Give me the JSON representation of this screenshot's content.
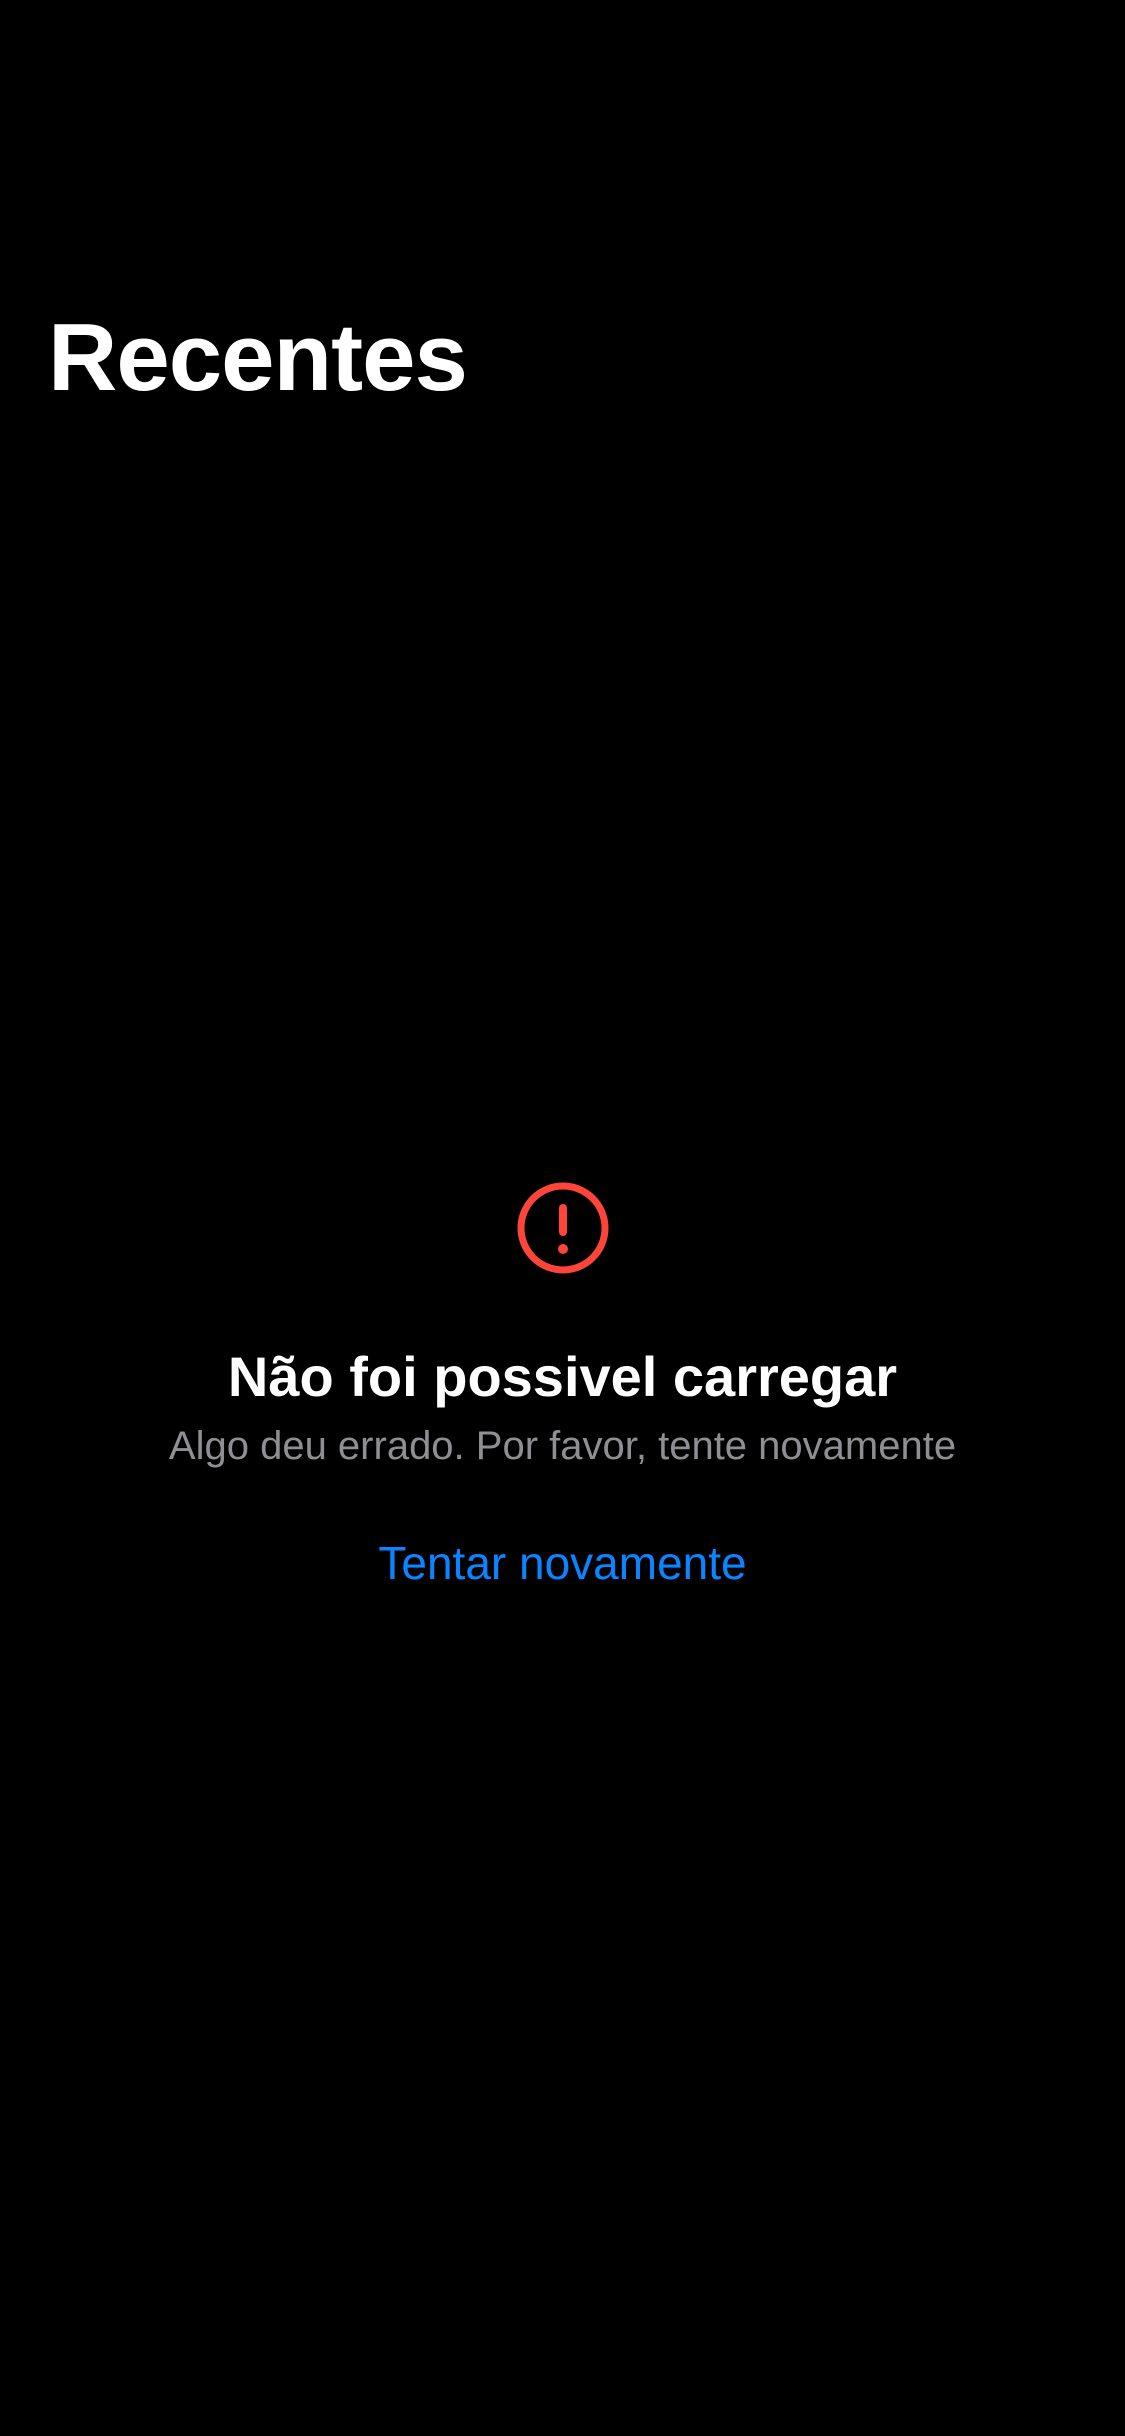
{
  "header": {
    "title": "Recentes"
  },
  "error_state": {
    "icon": "exclamation-circle-icon",
    "title": "Não foi possivel carregar",
    "message": "Algo deu errado. Por favor, tente novamente",
    "retry_label": "Tentar novamente"
  },
  "colors": {
    "background": "#000000",
    "title_text": "#ffffff",
    "secondary_text": "#8e8e93",
    "error_icon": "#ff453a",
    "accent_link": "#0a84ff"
  }
}
